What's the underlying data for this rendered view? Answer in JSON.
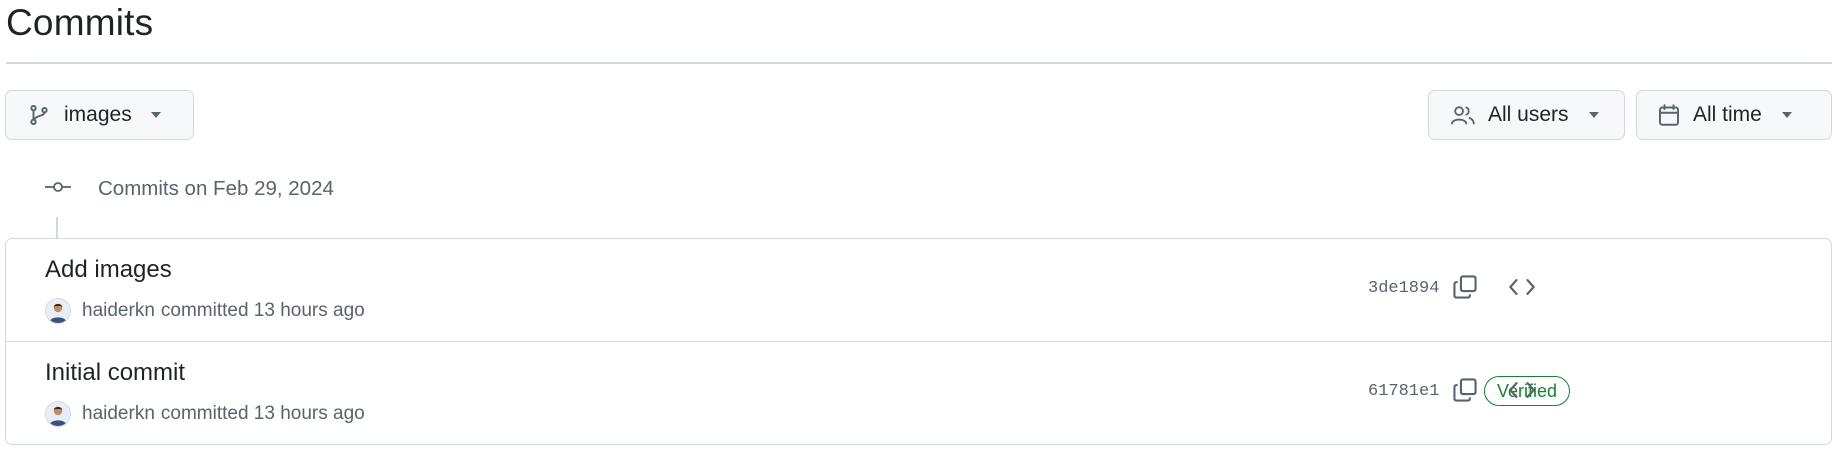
{
  "page": {
    "title": "Commits"
  },
  "toolbar": {
    "branch": {
      "label": "images",
      "icon": "git-branch-icon"
    },
    "users": {
      "label": "All users",
      "icon": "people-icon"
    },
    "time": {
      "label": "All time",
      "icon": "calendar-icon"
    }
  },
  "group": {
    "label": "Commits on Feb 29, 2024",
    "icon": "git-commit-icon"
  },
  "commits": [
    {
      "title": "Add images",
      "author": "haiderkn",
      "action_text": "committed 13 hours ago",
      "sha": "3de1894",
      "verified": false
    },
    {
      "title": "Initial commit",
      "author": "haiderkn",
      "action_text": "committed 13 hours ago",
      "sha": "61781e1",
      "verified": true,
      "verified_label": "Verified"
    }
  ],
  "colors": {
    "border": "#d1d9e0",
    "muted_text": "#59636e",
    "verified_green": "#1a7f37",
    "button_bg": "#f6f8fa"
  }
}
